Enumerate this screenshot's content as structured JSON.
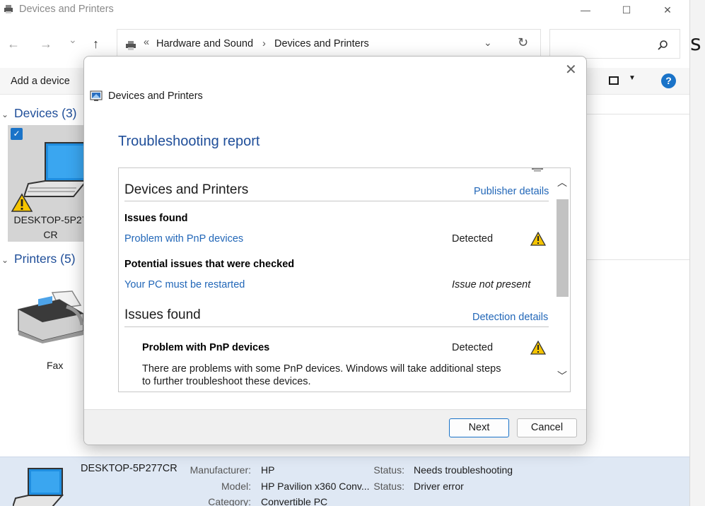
{
  "window": {
    "title": "Devices and Printers",
    "minimize_glyph": "—",
    "maximize_glyph": "☐",
    "close_glyph": "✕"
  },
  "nav": {
    "back_glyph": "←",
    "forward_glyph": "→",
    "history_glyph": "⌄",
    "up_glyph": "↑",
    "address_prefix": "«",
    "breadcrumb": [
      "Hardware and Sound",
      "Devices and Printers"
    ],
    "breadcrumb_separator": "›",
    "dropdown_glyph": "⌄",
    "refresh_glyph": "↻"
  },
  "toolbar": {
    "add_device_label": "Add a device",
    "help_label": "?"
  },
  "sections": {
    "devices": {
      "label": "Devices",
      "count": "(3)"
    },
    "printers": {
      "label": "Printers",
      "count": "(5)"
    }
  },
  "devices": [
    {
      "label_line1": "DESKTOP-5P27",
      "label_line2": "CR",
      "selected": true,
      "warning": true,
      "icon": "laptop-icon"
    }
  ],
  "printers": [
    {
      "label": "Fax",
      "icon": "fax-icon"
    }
  ],
  "right_strip_text": "s",
  "details": {
    "name": "DESKTOP-5P277CR",
    "fields": [
      {
        "key": "Manufacturer:",
        "value": "HP"
      },
      {
        "key": "Model:",
        "value": "HP Pavilion x360 Conv..."
      },
      {
        "key": "Category:",
        "value": "Convertible PC"
      }
    ],
    "status_fields": [
      {
        "key": "Status:",
        "value": "Needs troubleshooting"
      },
      {
        "key": "Status:",
        "value": "Driver error"
      }
    ]
  },
  "dialog": {
    "title": "Devices and Printers",
    "close_glyph": "✕",
    "heading": "Troubleshooting report",
    "report": {
      "section_title": "Devices and Printers",
      "publisher_link": "Publisher details",
      "issues_found_label": "Issues found",
      "issue_link": "Problem with PnP devices",
      "issue_status": "Detected",
      "potential_label": "Potential issues that were checked",
      "potential_link": "Your PC must be restarted",
      "potential_status": "Issue not present",
      "issues_section_title": "Issues found",
      "detection_link": "Detection details",
      "detail_title": "Problem with PnP devices",
      "detail_status": "Detected",
      "detail_text_line1": "There are problems with some PnP devices. Windows will take additional steps",
      "detail_text_line2": "to further troubleshoot these devices.",
      "scroll_up": "︿",
      "scroll_down": "﹀"
    },
    "buttons": {
      "next": "Next",
      "cancel": "Cancel"
    }
  },
  "colors": {
    "accent": "#1a73c8",
    "link": "#2267b8",
    "heading": "#1f4e99",
    "warning": "#f5c400",
    "details_bg": "#dfe8f4"
  }
}
